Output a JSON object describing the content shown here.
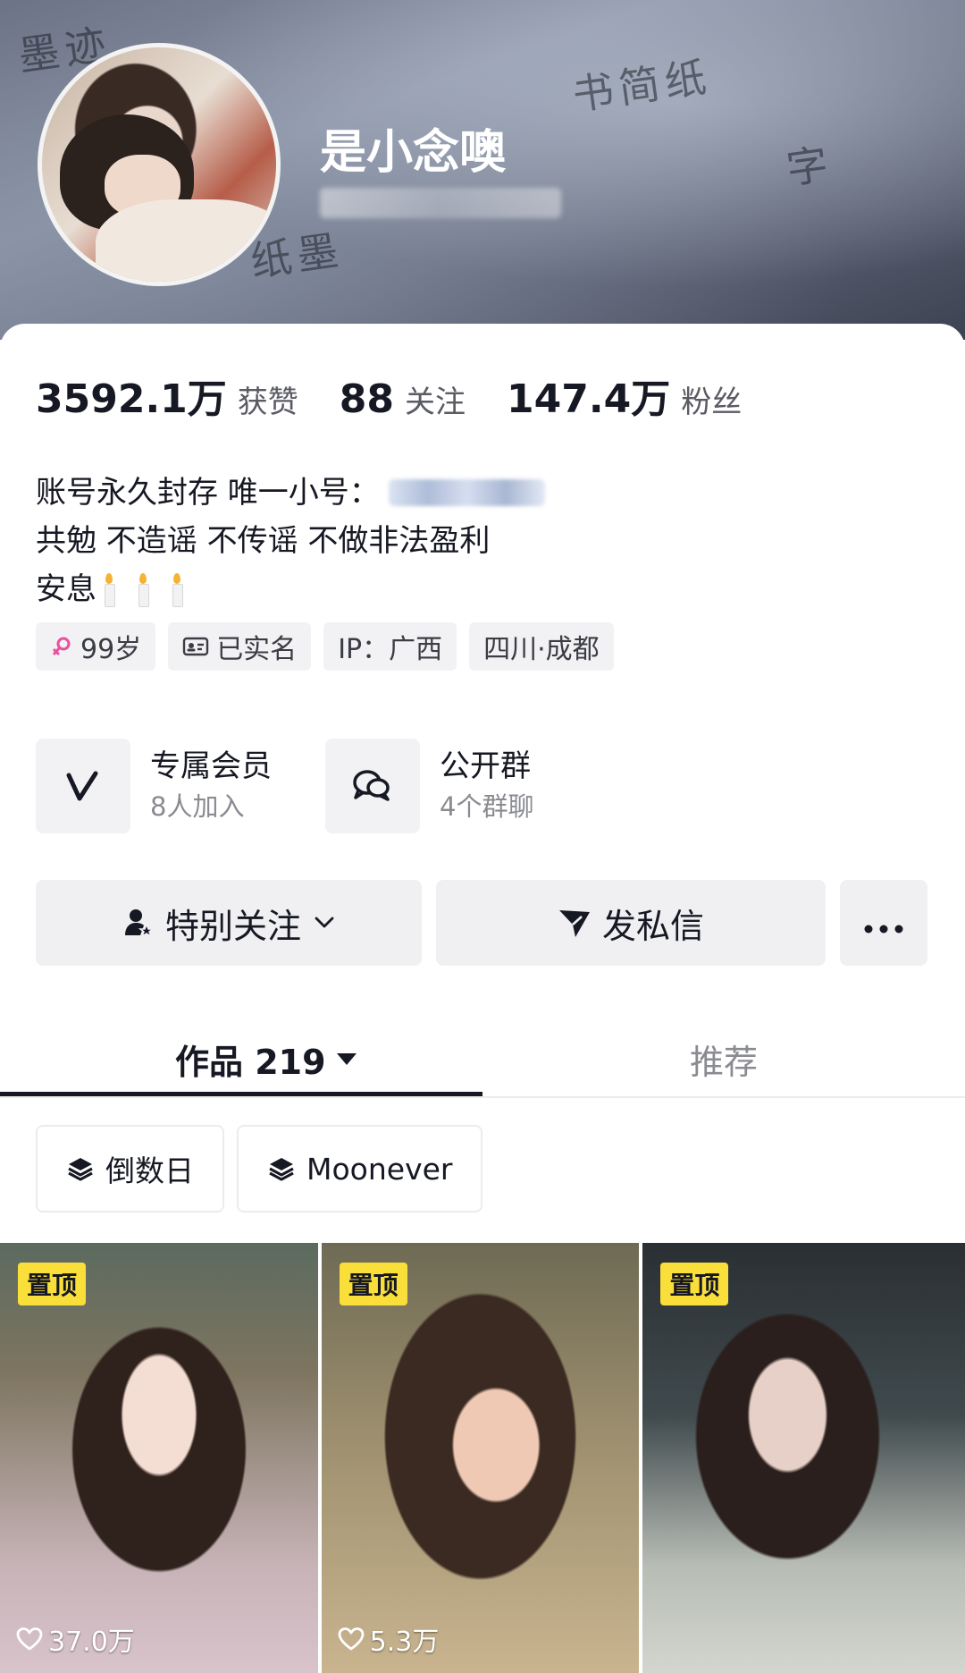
{
  "profile": {
    "nickname": "是小念噢"
  },
  "stats": [
    {
      "value": "3592.1万",
      "label": "获赞"
    },
    {
      "value": "88",
      "label": "关注"
    },
    {
      "value": "147.4万",
      "label": "粉丝"
    }
  ],
  "bio": {
    "line1": "账号永久封存 唯一小号：",
    "line2": "共勉 不造谣 不传谣 不做非法盈利",
    "line3": "安息"
  },
  "tags": {
    "age": "99岁",
    "verified": "已实名",
    "ip": "IP：广西",
    "location": "四川·成都"
  },
  "groups": {
    "member": {
      "title": "专属会员",
      "subtitle": "8人加入"
    },
    "chat": {
      "title": "公开群",
      "subtitle": "4个群聊"
    }
  },
  "actions": {
    "follow": "特别关注",
    "message": "发私信"
  },
  "tabs": {
    "works": "作品 219",
    "recommend": "推荐"
  },
  "collections": [
    {
      "label": "倒数日"
    },
    {
      "label": "Moonever"
    }
  ],
  "videos": [
    {
      "badge": "置顶",
      "likes": "37.0万"
    },
    {
      "badge": "置顶",
      "likes": "5.3万"
    },
    {
      "badge": "置顶",
      "likes": ""
    }
  ],
  "colors": {
    "pin_badge": "#fadf3a",
    "text_primary": "#161823",
    "text_secondary": "#8a8b91"
  }
}
